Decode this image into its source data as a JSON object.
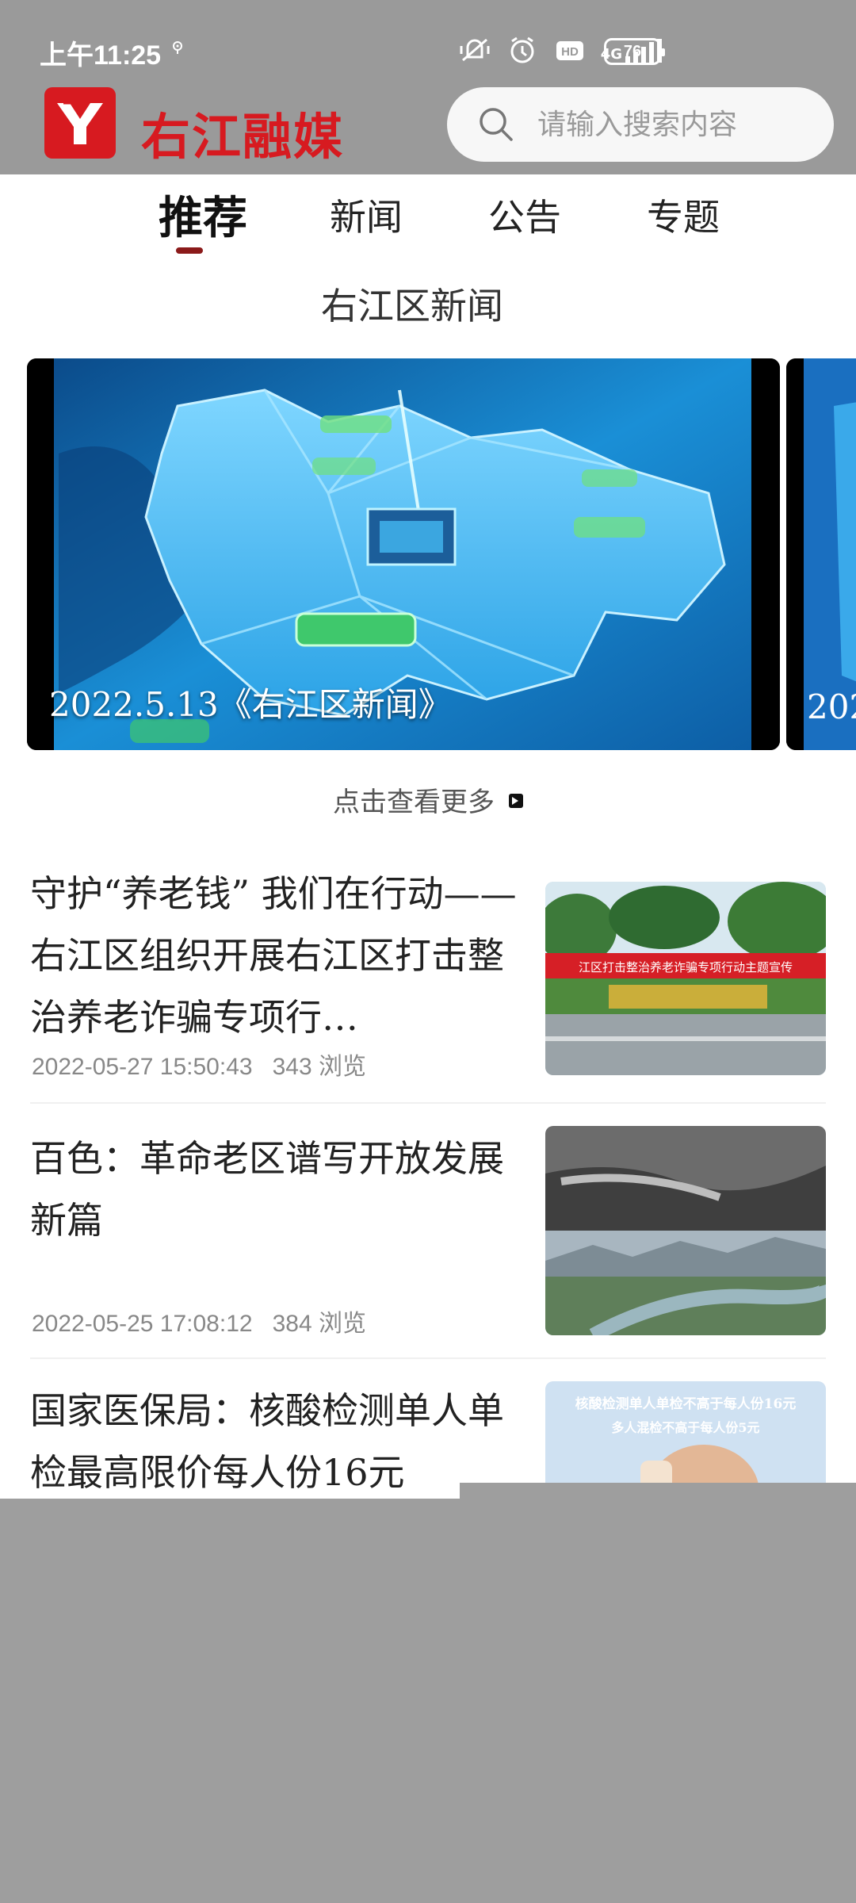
{
  "status_bar": {
    "time": "上午11:25",
    "network": "4G",
    "battery": "76"
  },
  "header": {
    "logo_text": "右江融媒",
    "search_placeholder": "请输入搜索内容"
  },
  "tabs": [
    {
      "label": "推荐",
      "active": true
    },
    {
      "label": "新闻",
      "active": false
    },
    {
      "label": "公告",
      "active": false
    },
    {
      "label": "专题",
      "active": false
    }
  ],
  "section": {
    "title": "右江区新闻"
  },
  "carousel": {
    "items": [
      {
        "caption": "2022.5.13《右江区新闻》"
      },
      {
        "caption": "202"
      }
    ]
  },
  "more_link": "点击查看更多",
  "news": [
    {
      "title": "守护“养老钱” 我们在行动——右江区组织开展右江区打击整治养老诈骗专项行…",
      "date": "2022-05-27 15:50:43",
      "views": "343 浏览",
      "thumb_banner": "江区打击整治养老诈骗专项行动主题宣传"
    },
    {
      "title": "百色：革命老区谱写开放发展新篇",
      "date": "2022-05-25 17:08:12",
      "views": "384 浏览"
    },
    {
      "title": "国家医保局：核酸检测单人单检最高限价每人份16元",
      "thumb_line1": "核酸检测单人单检不高于每人份16元",
      "thumb_line2": "多人混检不高于每人份5元"
    }
  ],
  "colors": {
    "brand_red": "#d71a20",
    "tab_indicator": "#8b1a1a",
    "header_gray": "#9a9a9a"
  }
}
